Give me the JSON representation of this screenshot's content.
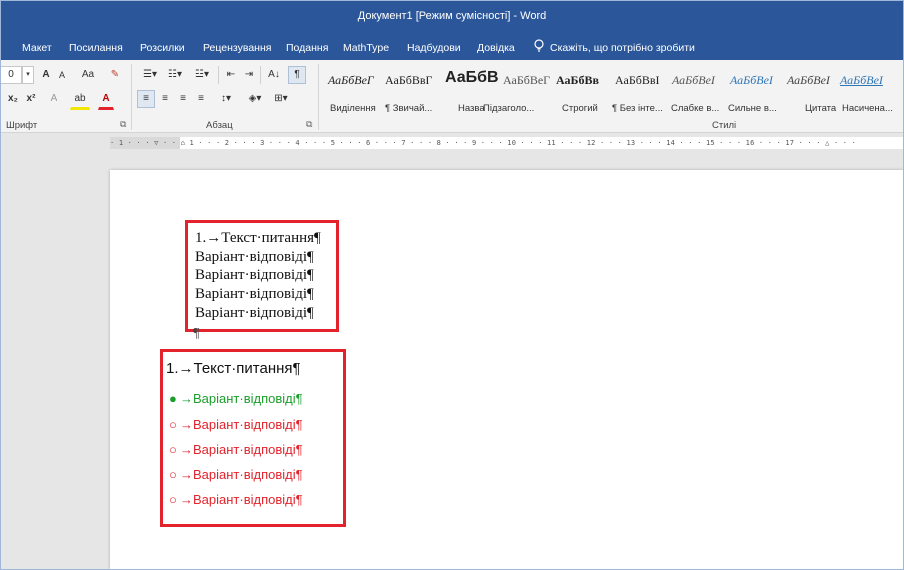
{
  "window": {
    "title": "Документ1 [Режим сумісності]  -  Word"
  },
  "tabs": [
    "Макет",
    "Посилання",
    "Розсилки",
    "Рецензування",
    "Подання",
    "MathType",
    "Надбудови",
    "Довідка"
  ],
  "tellme": {
    "text": "Скажіть, що потрібно зробити",
    "icon": "lightbulb-icon"
  },
  "ribbon": {
    "font_group_label": "Шрифт",
    "paragraph_group_label": "Абзац",
    "styles_group_label": "Стилі",
    "aa_label": "Aa",
    "superscript": "x²",
    "subscript": "x₂",
    "font_size_frag": "0",
    "grow_font": "A",
    "shrink_font": "A",
    "highlight": "ab",
    "font_color": "A",
    "clear_icon": "eraser-icon",
    "sort_label": "A↓",
    "show_marks_label": "¶",
    "styles": [
      {
        "sample": "АаБбВеГ",
        "name": "Виділення",
        "color": "#222222",
        "italic": true
      },
      {
        "sample": "АаБбВвГ",
        "name": "¶ Звичай...",
        "color": "#222222",
        "italic": false
      },
      {
        "sample": "АаБбВ",
        "name": "Назва",
        "color": "#222222",
        "italic": false,
        "large": true
      },
      {
        "sample": "АаБбВеГ",
        "name": "Підзаголо...",
        "color": "#555555",
        "italic": false
      },
      {
        "sample": "АаБбВв",
        "name": "Строгий",
        "color": "#222222",
        "italic": false,
        "bold": true
      },
      {
        "sample": "АаБбВвІ",
        "name": "¶ Без інте...",
        "color": "#222222",
        "italic": false
      },
      {
        "sample": "АаБбВеІ",
        "name": "Слабке в...",
        "color": "#555555",
        "italic": true
      },
      {
        "sample": "АаБбВеІ",
        "name": "Сильне в...",
        "color": "#2e75b6",
        "italic": true
      },
      {
        "sample": "АаБбВеІ",
        "name": "Цитата",
        "color": "#444444",
        "italic": true
      },
      {
        "sample": "АаБбВеІ",
        "name": "Насичена...",
        "color": "#2e75b6",
        "italic": true,
        "underline": true
      }
    ]
  },
  "ruler": {
    "text": "· 1 · · · ▽ · · ⌂ 1 · · · 2 · · · 3 · · · 4 · · · 5 · · · 6 · · · 7 · · · 8 · · · 9 · · · 10 · · · 11 · · · 12 · · · 13 · · · 14 · · · 15 · · · 16 · · · 17 · · · △ · · ·"
  },
  "document": {
    "block1": {
      "question": "1.→Текст·питання¶",
      "answers": [
        "Варіант·відповіді¶",
        "Варіант·відповіді¶",
        "Варіант·відповіді¶",
        "Варіант·відповіді¶"
      ]
    },
    "empty_paragraph": "¶",
    "block2": {
      "question": "1.→Текст·питання¶",
      "answers": [
        {
          "marker": "●",
          "text": "→Варіант·відповіді¶",
          "correct": true
        },
        {
          "marker": "○",
          "text": "→Варіант·відповіді¶",
          "correct": false
        },
        {
          "marker": "○",
          "text": "→Варіант·відповіді¶",
          "correct": false
        },
        {
          "marker": "○",
          "text": "→Варіант·відповіді¶",
          "correct": false
        },
        {
          "marker": "○",
          "text": "→Варіант·відповіді¶",
          "correct": false
        }
      ],
      "correct_color": "#1a9e2a",
      "wrong_color": "#e3232c"
    },
    "highlight_color": "#e3232c"
  },
  "colors": {
    "titlebar": "#2b579a",
    "ribbon": "#f3f3f3"
  }
}
